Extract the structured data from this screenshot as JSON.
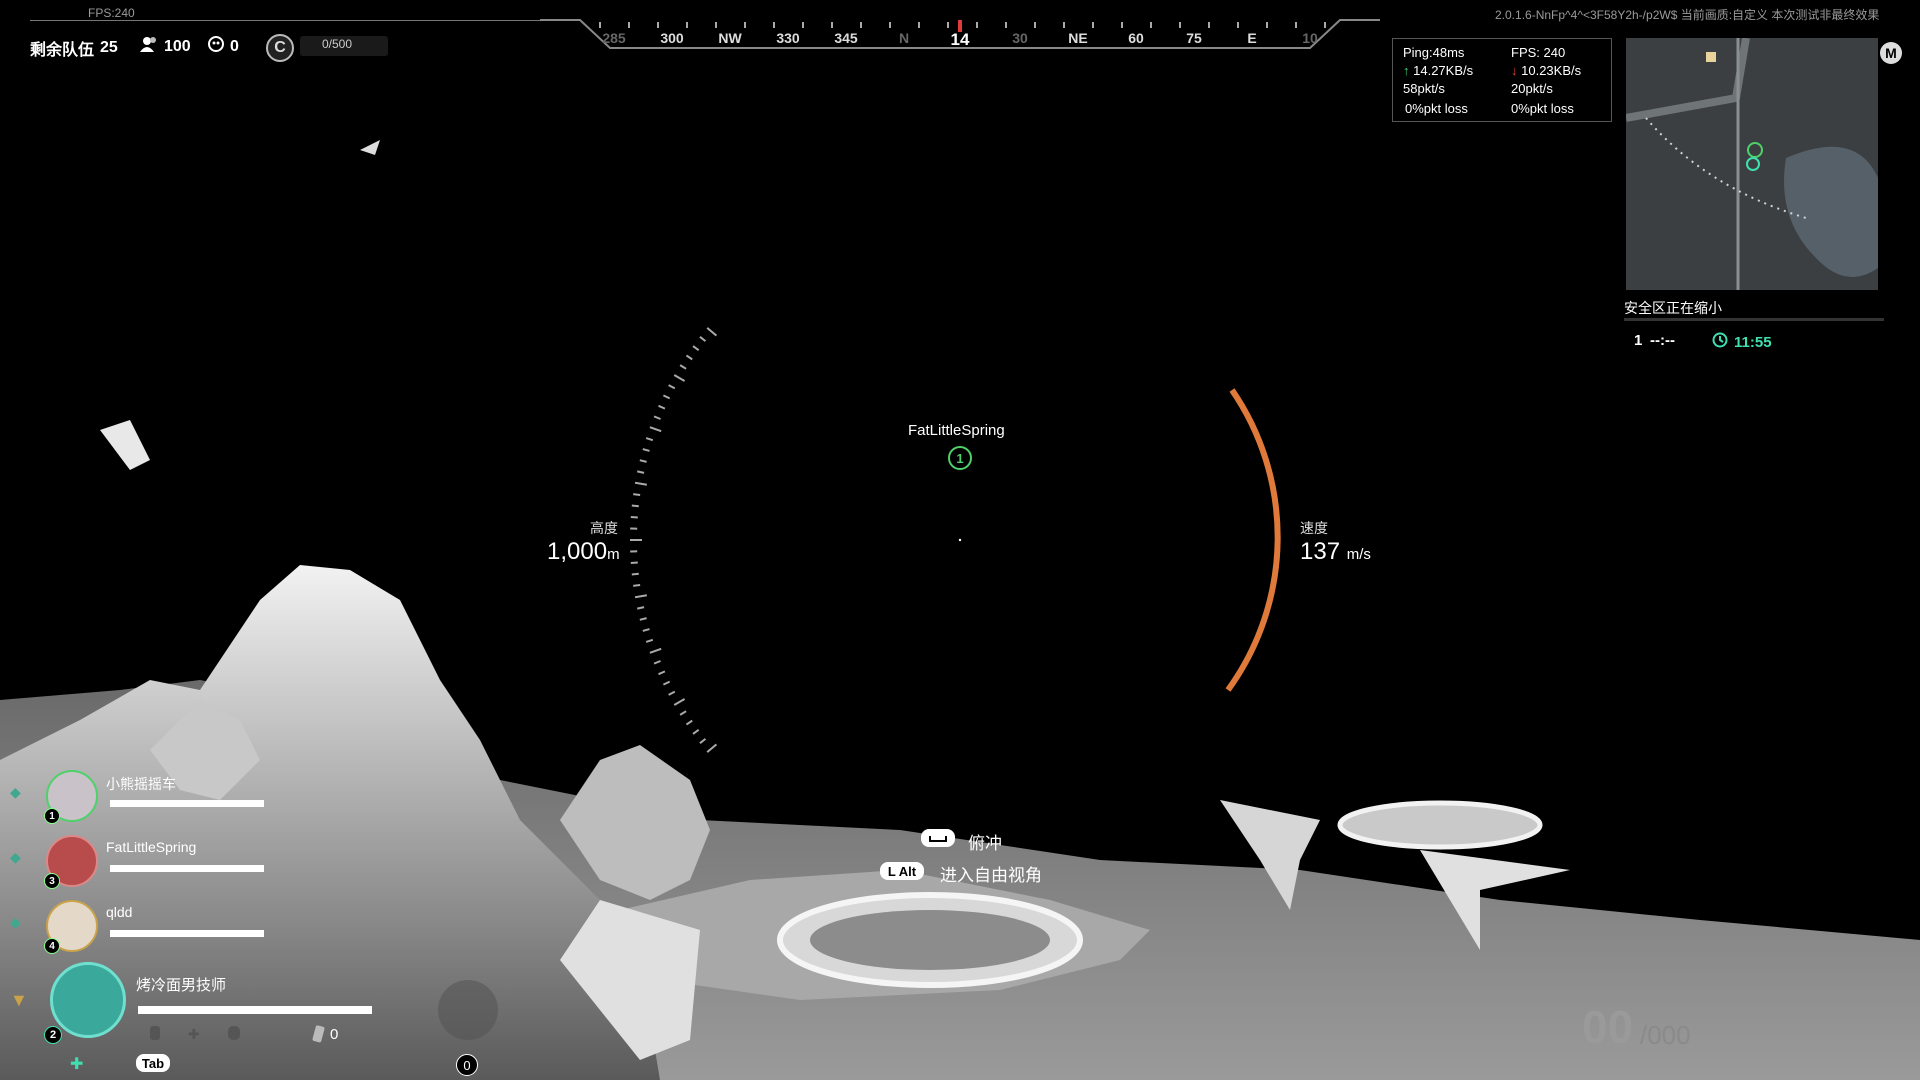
{
  "top_left": {
    "fps": "FPS:240",
    "teams_label": "剩余队伍",
    "teams_remaining": "25",
    "players": "100",
    "kills": "0",
    "season_icon": "C",
    "season_progress": "0/500"
  },
  "compass": {
    "ticks": [
      "285",
      "300",
      "NW",
      "330",
      "345",
      "N",
      "30",
      "NE",
      "60",
      "75",
      "E",
      "10"
    ],
    "current": "14",
    "marker_color": "#e03a3a"
  },
  "top_right": {
    "version": "2.0.1.6-NnFp^4^<3F58Y2h-/p2W$   当前画质:自定义   本次测试非最终效果",
    "net": {
      "ping": "Ping:48ms",
      "fps": "FPS:  240",
      "up_speed": "14.27KB/s",
      "down_speed": "10.23KB/s",
      "up_pkt": "58pkt/s",
      "down_pkt": "20pkt/s",
      "up_loss": "0%pkt loss",
      "down_loss": "0%pkt loss"
    },
    "map_key": "M",
    "zone_message": "安全区正在缩小",
    "zone_phase": "1",
    "zone_countdown": "--:--",
    "zone_timer": "11:55",
    "zone_color": "#3fe0b0"
  },
  "center": {
    "altitude_label": "高度",
    "altitude_value": "1,000",
    "altitude_unit": "m",
    "speed_label": "速度",
    "speed_value": "137",
    "speed_unit": "m/s",
    "speed_arc_color": "#e07a3a",
    "teammate_tag": "FatLittleSpring",
    "teammate_marker": "1"
  },
  "prompts": {
    "dive_key": "",
    "dive_label": "俯冲",
    "freecam_key": "L Alt",
    "freecam_label": "进入自由视角"
  },
  "team": {
    "mates": [
      {
        "num": "1",
        "name": "小熊摇摇车"
      },
      {
        "num": "3",
        "name": "FatLittleSpring"
      },
      {
        "num": "4",
        "name": "qldd"
      }
    ],
    "self": {
      "num": "2",
      "name": "烤冷面男技师",
      "ammo": "0",
      "tab_key": "Tab",
      "zero_badge": "0"
    }
  },
  "ammo": {
    "count": "00",
    "total": "/000"
  }
}
